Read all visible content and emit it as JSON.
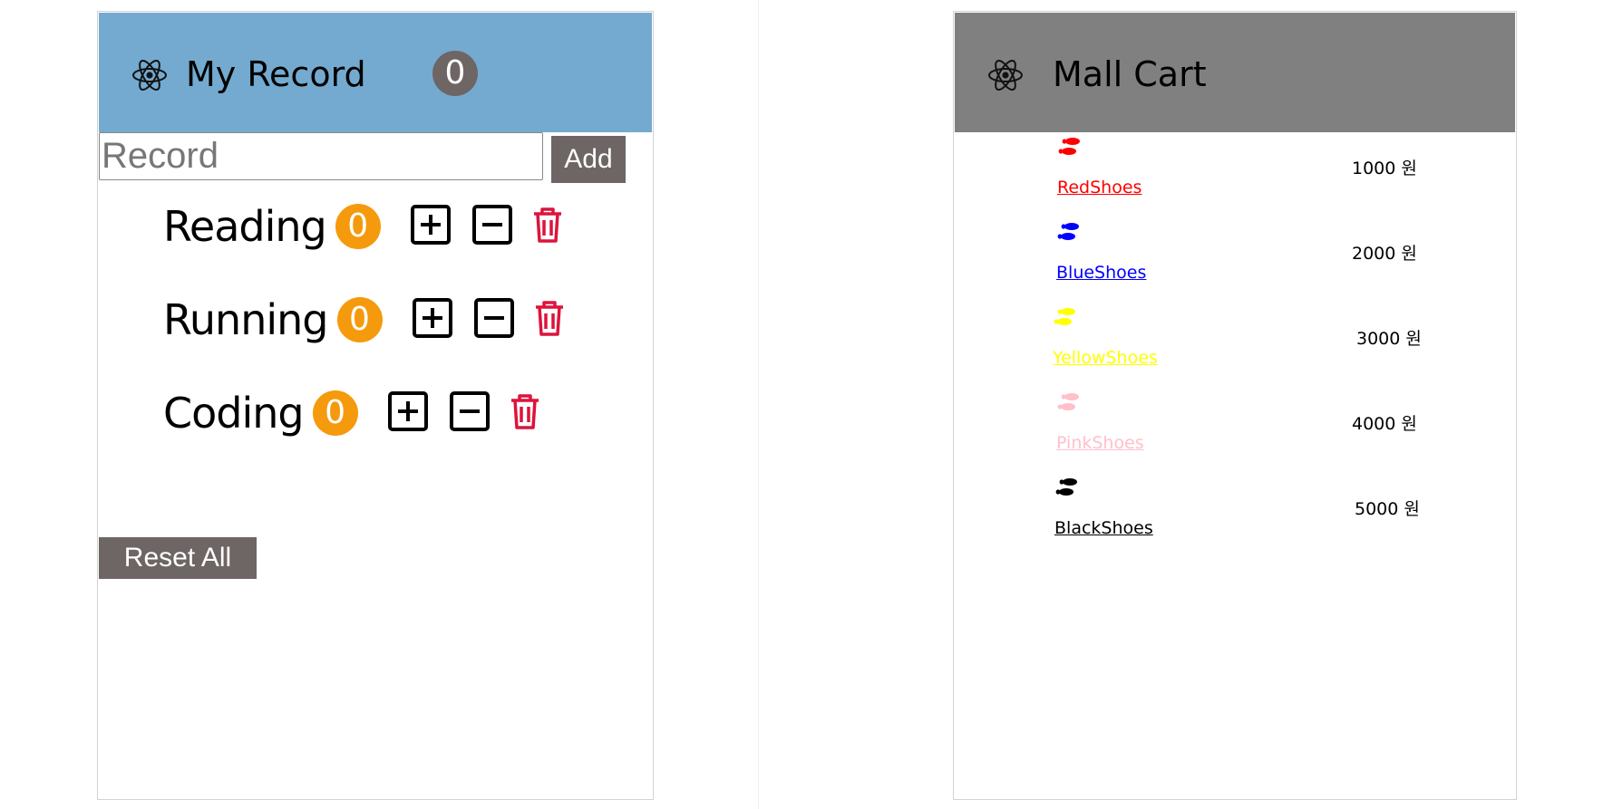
{
  "record_panel": {
    "title": "My Record",
    "total_count": "0",
    "input_placeholder": "Record",
    "add_label": "Add",
    "reset_label": "Reset All",
    "items": [
      {
        "name": "Reading",
        "count": "0"
      },
      {
        "name": "Running",
        "count": "0"
      },
      {
        "name": "Coding",
        "count": "0"
      }
    ],
    "colors": {
      "header_bg": "#74aacf",
      "count_badge": "#f59a0c",
      "total_badge": "#6e6565",
      "button_bg": "#6e6565",
      "trash": "#dc143c"
    },
    "icons": [
      "react-logo",
      "plus-square",
      "minus-square",
      "trash"
    ]
  },
  "cart_panel": {
    "title": "Mall Cart",
    "header_bg": "#808080",
    "items": [
      {
        "name": "RedShoes",
        "price": "1000 원",
        "color": "#ff0000",
        "icon": "shoe-prints"
      },
      {
        "name": "BlueShoes",
        "price": "2000 원",
        "color": "#0000ff",
        "icon": "shoe-prints"
      },
      {
        "name": "YellowShoes",
        "price": "3000 원",
        "color": "#ffff00",
        "icon": "shoe-prints"
      },
      {
        "name": "PinkShoes",
        "price": "4000 원",
        "color": "#ffc0cb",
        "icon": "shoe-prints"
      },
      {
        "name": "BlackShoes",
        "price": "5000 원",
        "color": "#000000",
        "icon": "shoe-prints"
      }
    ]
  }
}
